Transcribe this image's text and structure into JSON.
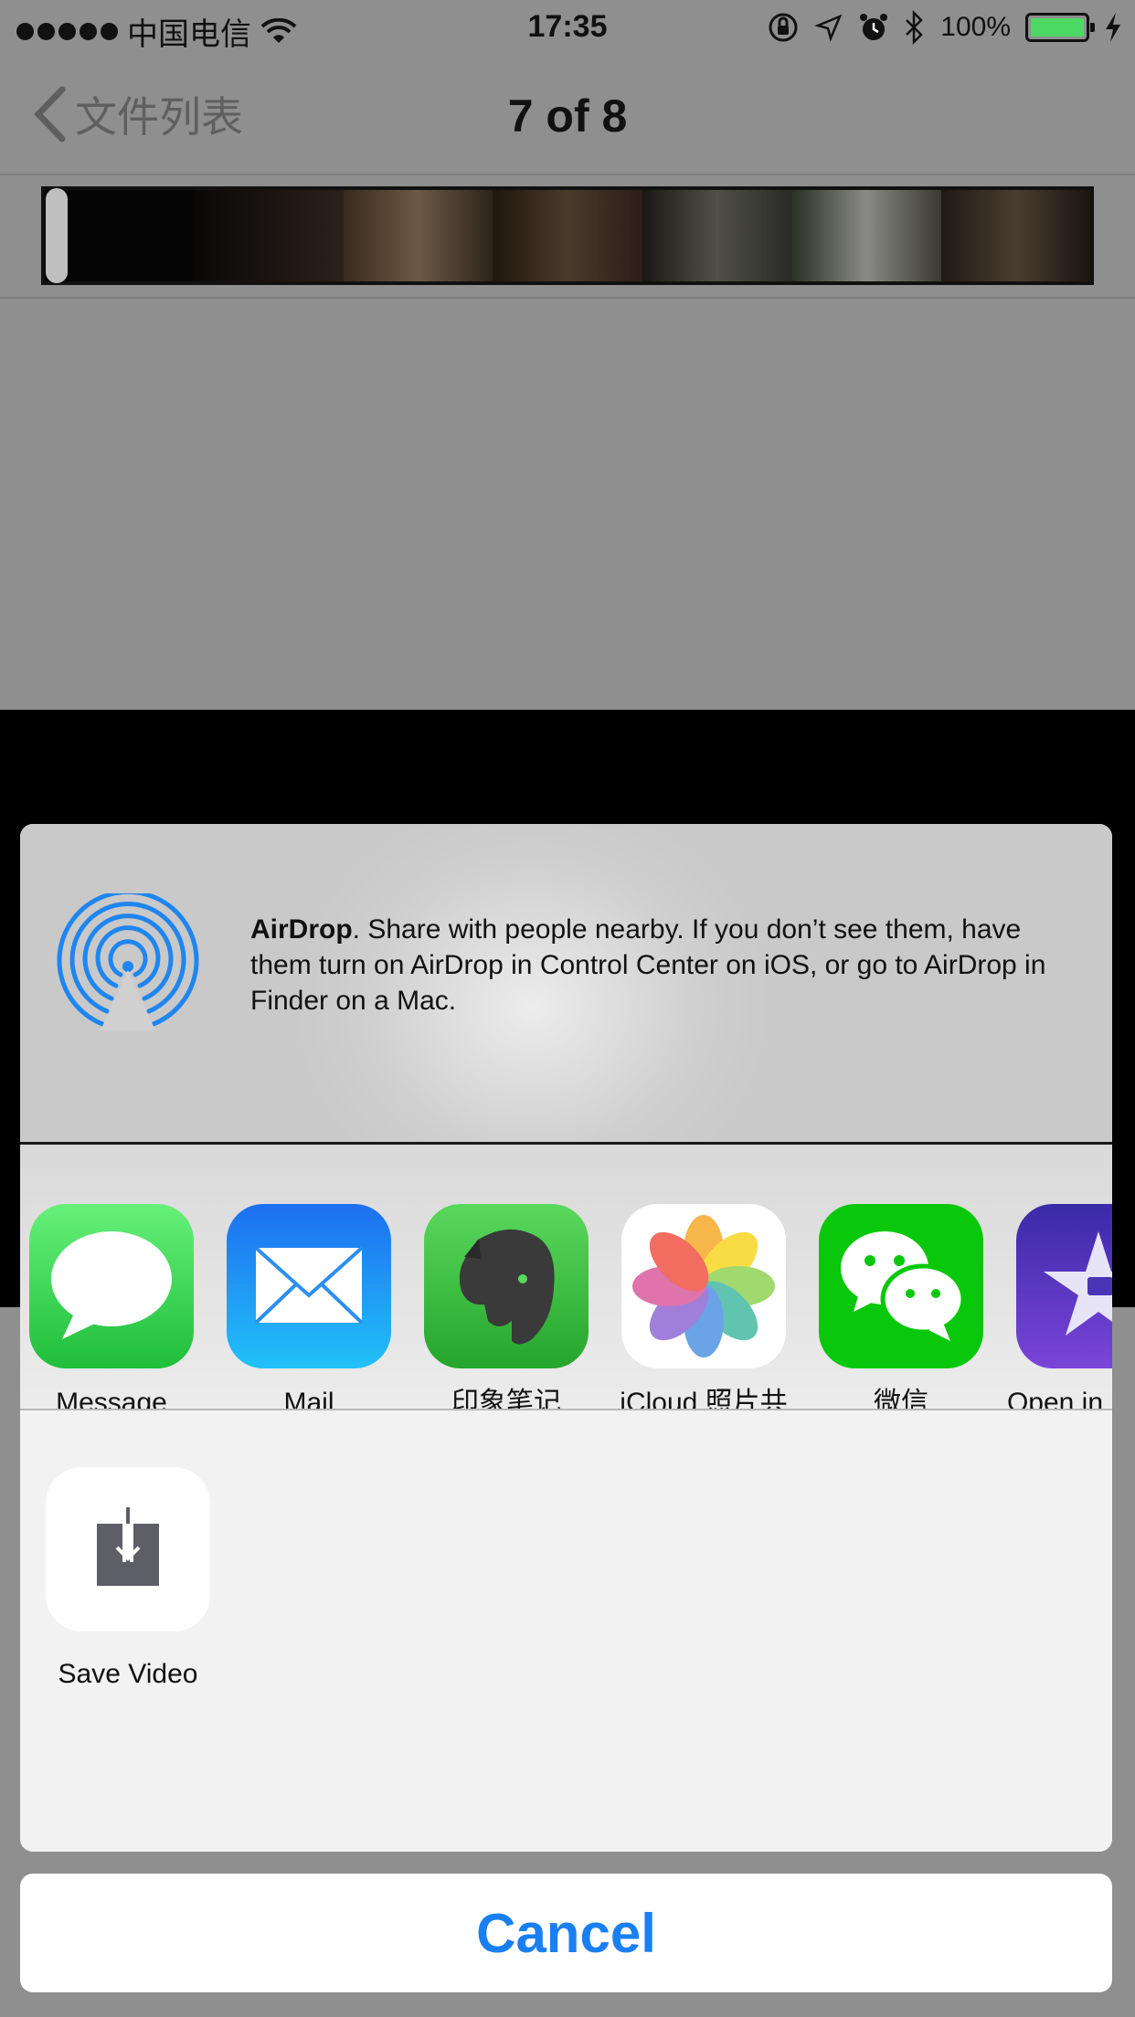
{
  "status_bar": {
    "carrier": "中国电信",
    "time": "17:35",
    "battery_percent": "100%",
    "battery_level": 1.0,
    "icons": [
      "signal-dots-icon",
      "wifi-icon",
      "orientation-lock-icon",
      "location-icon",
      "alarm-icon",
      "bluetooth-icon",
      "battery-icon",
      "charging-icon"
    ]
  },
  "nav": {
    "back_label": "文件列表",
    "title": "7 of 8"
  },
  "share_sheet": {
    "airdrop": {
      "title": "AirDrop",
      "description": ". Share with people nearby. If you don’t see them, have them turn on AirDrop in Control Center on iOS, or go to AirDrop in Finder on a Mac."
    },
    "apps": [
      {
        "label": "Message",
        "icon": "messages-icon",
        "color": "#34c84a"
      },
      {
        "label": "Mail",
        "icon": "mail-icon",
        "color": "#1f8ef1"
      },
      {
        "label": "印象笔记",
        "icon": "evernote-icon",
        "color": "#2dbe37"
      },
      {
        "label": "iCloud 照片共享",
        "icon": "photos-icon",
        "color": "#ffffff"
      },
      {
        "label": "微信",
        "icon": "wechat-icon",
        "color": "#09c80b"
      },
      {
        "label": "Open in iMovie",
        "icon": "imovie-icon",
        "color": "#5a35c9"
      }
    ],
    "actions": [
      {
        "label": "Save Video",
        "icon": "save-video-icon"
      }
    ],
    "cancel_label": "Cancel"
  },
  "colors": {
    "accent": "#1a7ff2",
    "airdrop_blue": "#1f86f0"
  }
}
